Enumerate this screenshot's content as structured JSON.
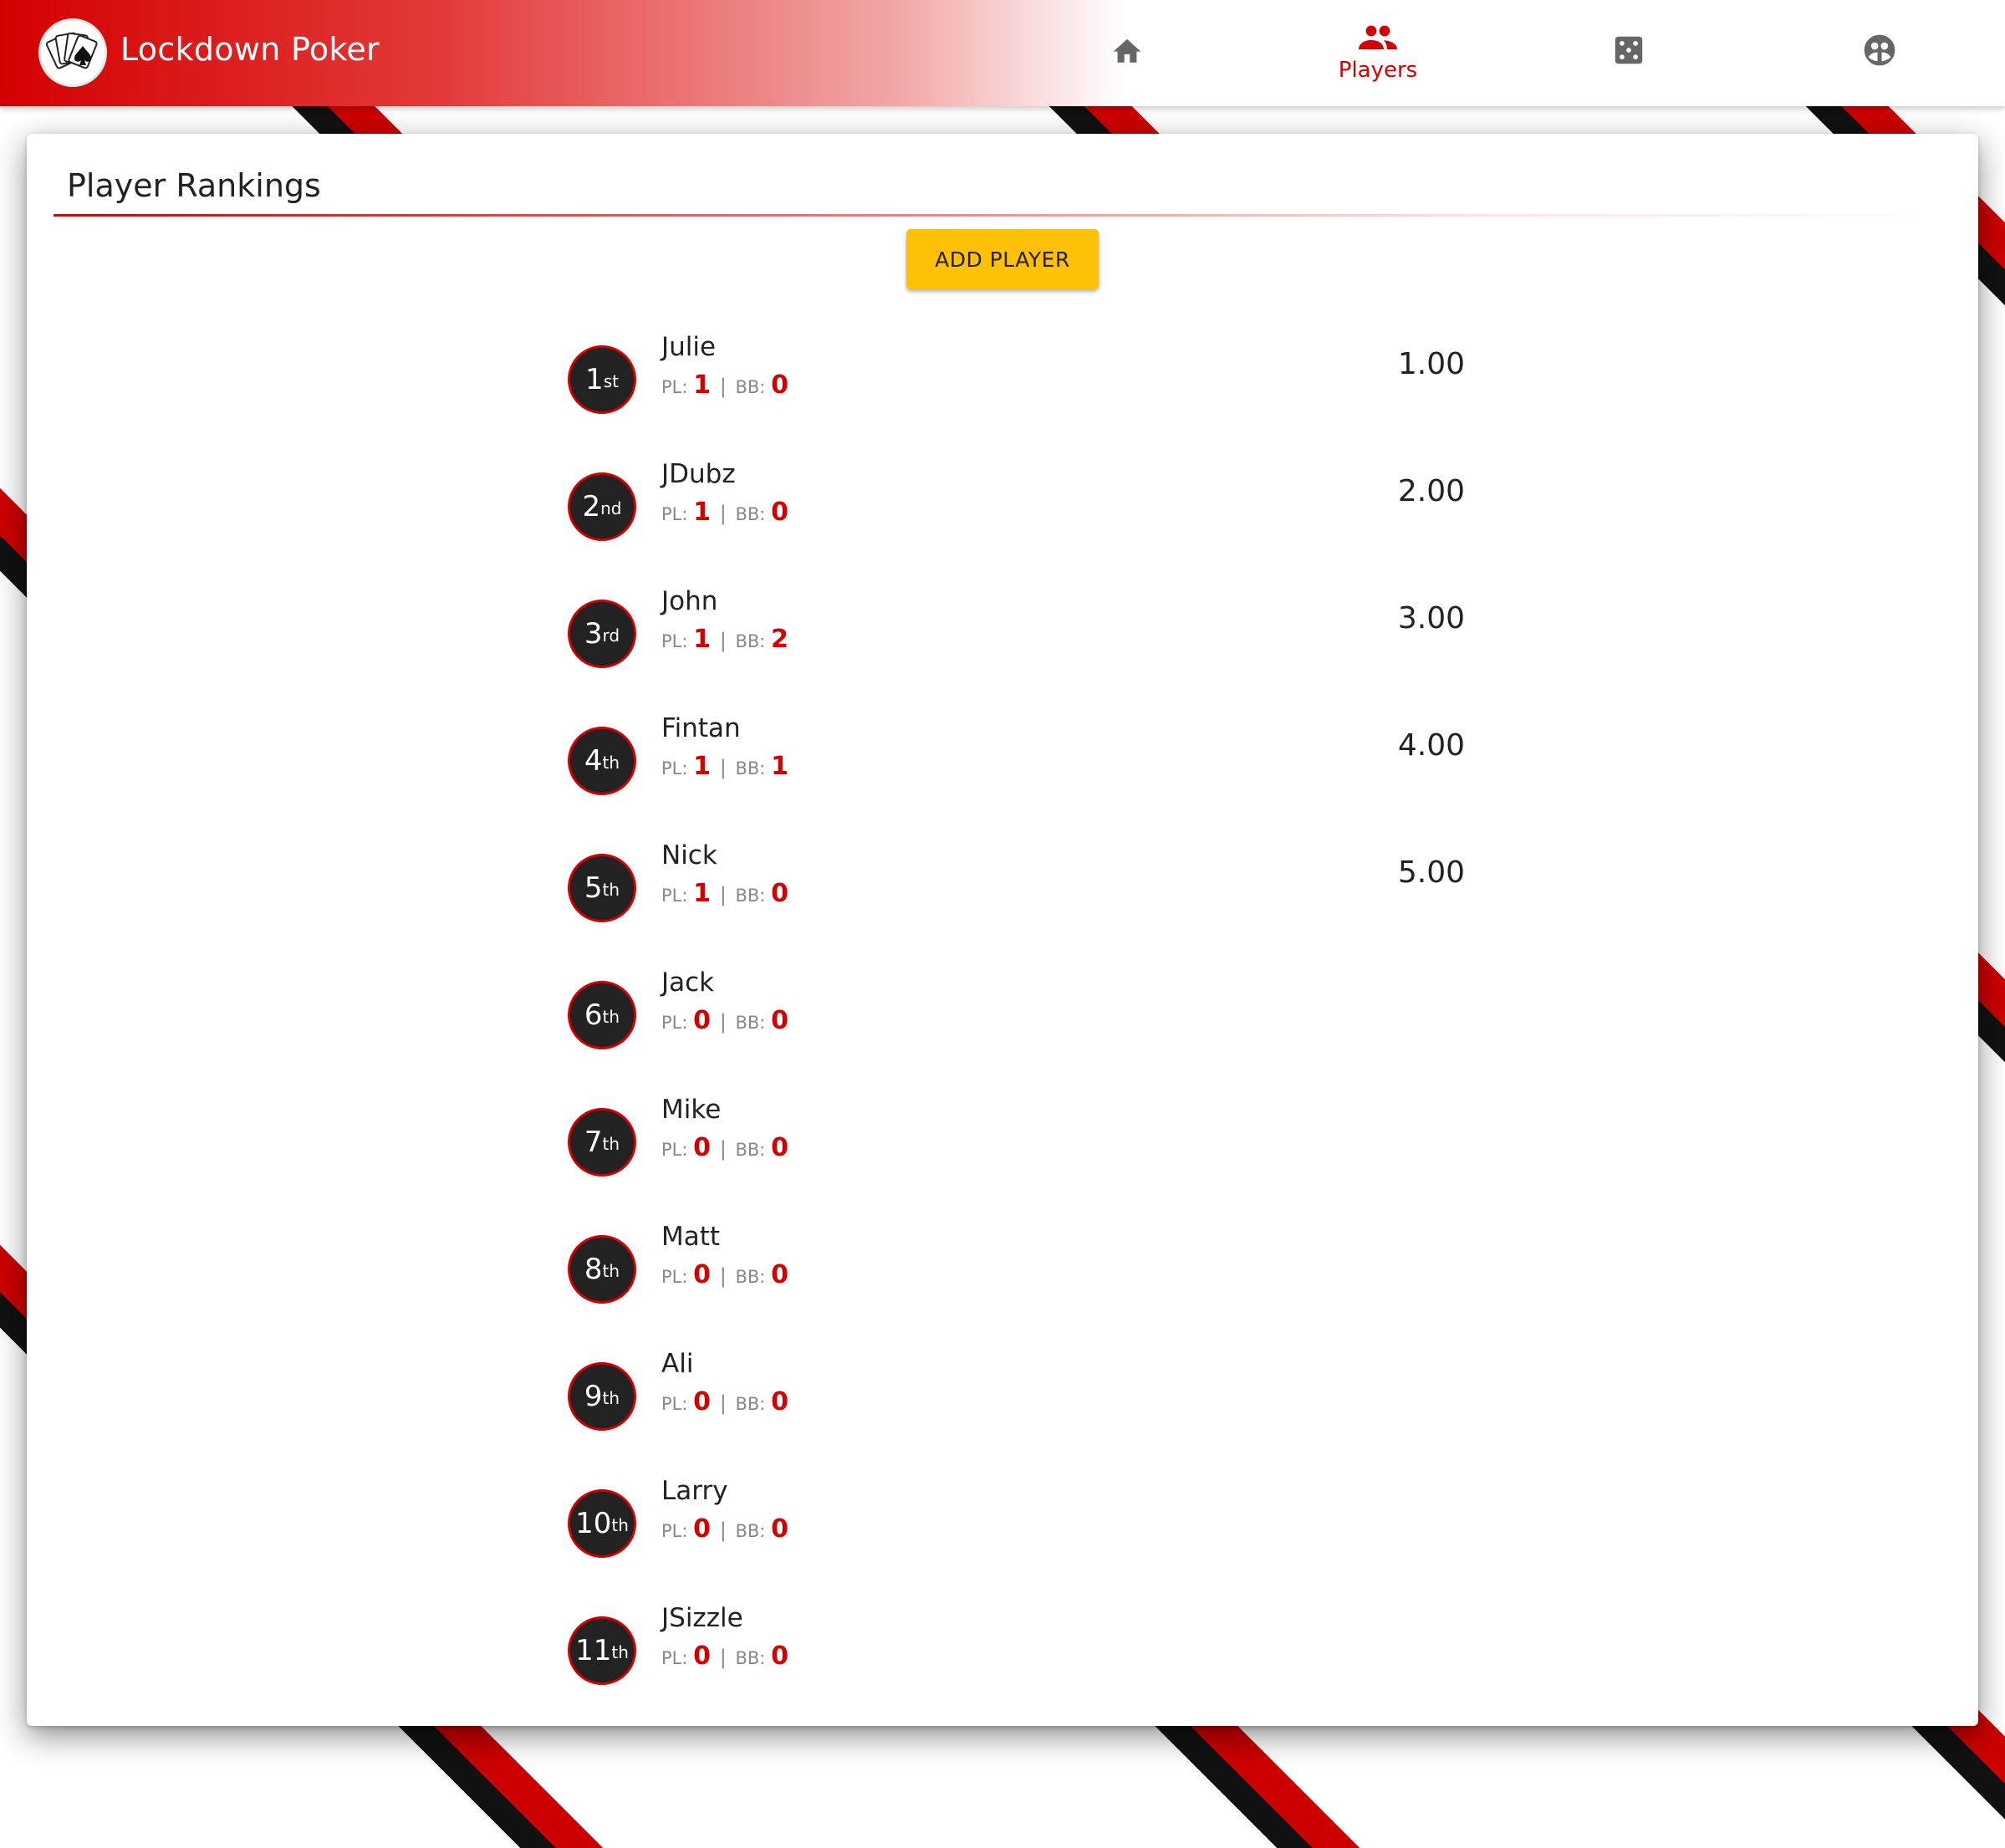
{
  "header": {
    "app_title": "Lockdown Poker",
    "nav": [
      {
        "label": "",
        "icon": "home-icon",
        "active": false
      },
      {
        "label": "Players",
        "icon": "players-icon",
        "active": true
      },
      {
        "label": "",
        "icon": "dice-icon",
        "active": false
      },
      {
        "label": "",
        "icon": "account-icon",
        "active": false
      }
    ]
  },
  "rankings": {
    "title": "Player Rankings",
    "add_button": "ADD PLAYER",
    "stat_labels": {
      "pl": "PL:",
      "sep": "|",
      "bb": "BB:"
    },
    "players": [
      {
        "rank": "1",
        "suffix": "st",
        "name": "Julie",
        "pl": "1",
        "bb": "0",
        "score": "1.00"
      },
      {
        "rank": "2",
        "suffix": "nd",
        "name": "JDubz",
        "pl": "1",
        "bb": "0",
        "score": "2.00"
      },
      {
        "rank": "3",
        "suffix": "rd",
        "name": "John",
        "pl": "1",
        "bb": "2",
        "score": "3.00"
      },
      {
        "rank": "4",
        "suffix": "th",
        "name": "Fintan",
        "pl": "1",
        "bb": "1",
        "score": "4.00"
      },
      {
        "rank": "5",
        "suffix": "th",
        "name": "Nick",
        "pl": "1",
        "bb": "0",
        "score": "5.00"
      },
      {
        "rank": "6",
        "suffix": "th",
        "name": "Jack",
        "pl": "0",
        "bb": "0",
        "score": ""
      },
      {
        "rank": "7",
        "suffix": "th",
        "name": "Mike",
        "pl": "0",
        "bb": "0",
        "score": ""
      },
      {
        "rank": "8",
        "suffix": "th",
        "name": "Matt",
        "pl": "0",
        "bb": "0",
        "score": ""
      },
      {
        "rank": "9",
        "suffix": "th",
        "name": "Ali",
        "pl": "0",
        "bb": "0",
        "score": ""
      },
      {
        "rank": "10",
        "suffix": "th",
        "name": "Larry",
        "pl": "0",
        "bb": "0",
        "score": ""
      },
      {
        "rank": "11",
        "suffix": "th",
        "name": "JSizzle",
        "pl": "0",
        "bb": "0",
        "score": ""
      }
    ]
  },
  "colors": {
    "accent": "#d40000",
    "button": "#ffc107",
    "badge": "#222222",
    "icon_gray": "#666666"
  }
}
